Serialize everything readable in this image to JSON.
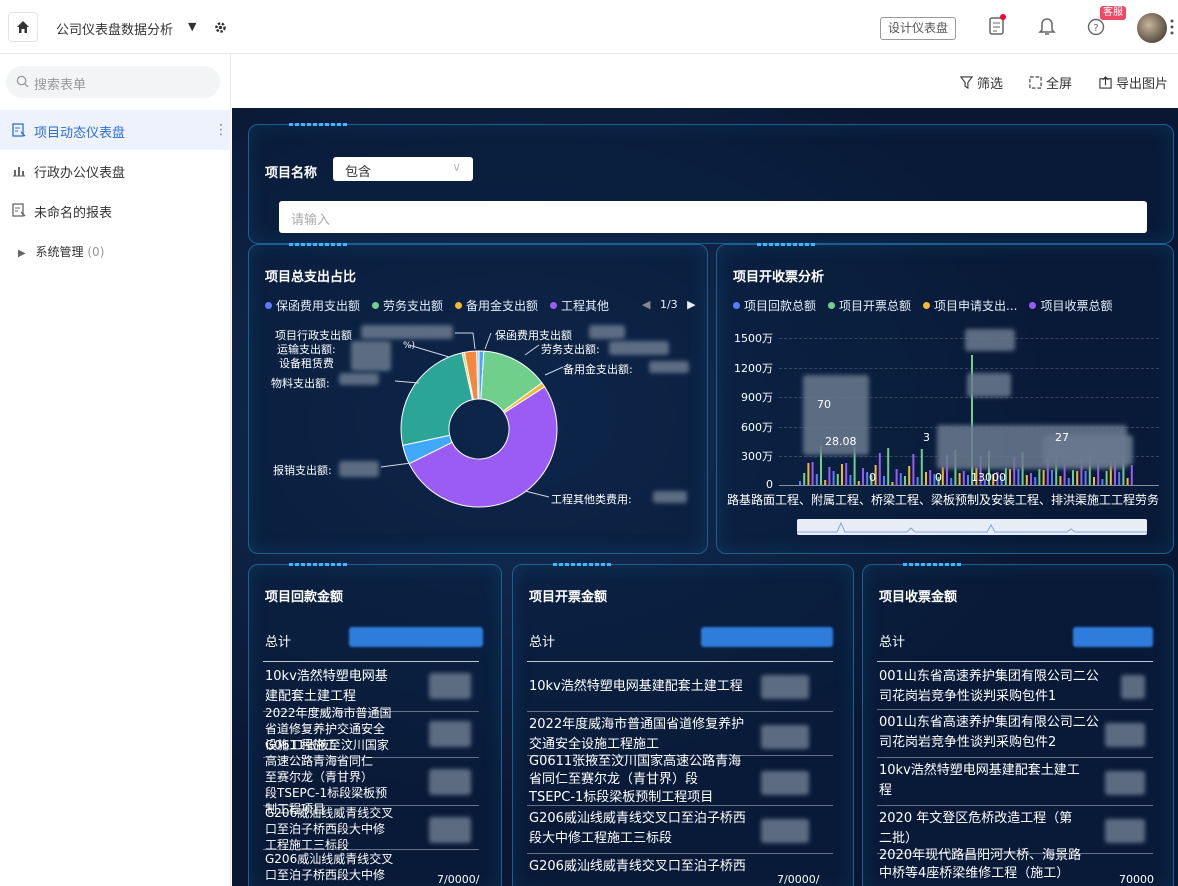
{
  "header": {
    "app_title": "公司仪表盘数据分析",
    "design_label": "设计仪表盘",
    "support_badge": "客服"
  },
  "sidebar": {
    "search_placeholder": "搜索表单",
    "items": [
      {
        "label": "项目动态仪表盘",
        "active": true
      },
      {
        "label": "行政办公仪表盘",
        "active": false
      },
      {
        "label": "未命名的报表",
        "active": false
      }
    ],
    "group": {
      "label": "系统管理",
      "count": "(0)"
    }
  },
  "toolbar": {
    "filter": "筛选",
    "fullscreen": "全屏",
    "export": "导出图片"
  },
  "filter_panel": {
    "label": "项目名称",
    "operator": "包含",
    "placeholder": "请输入"
  },
  "pie_panel": {
    "title": "项目总支出占比",
    "legend": [
      "保函费用支出额",
      "劳务支出额",
      "备用金支出额",
      "工程其他"
    ],
    "pager": "1/3",
    "labels": [
      "项目行政支出额",
      "运输支出额:",
      "设备租赁费",
      "物料支出额:",
      "报销支出额:",
      "保函费用支出额",
      "劳务支出额:",
      "备用金支出额:",
      "工程其他类费用: "
    ],
    "pct_hint": "%)"
  },
  "bar_panel": {
    "title": "项目开收票分析",
    "legend": [
      "项目回款总额",
      "项目开票总额",
      "项目申请支出...",
      "项目收票总额"
    ],
    "yticks": [
      "1500万",
      "1200万",
      "900万",
      "600万",
      "300万",
      "0"
    ],
    "xcats": "路基路面工程、附属工程、桥梁工程、梁板预制及安装工程、排洪渠施工工程劳务",
    "fragments": [
      "70",
      "28.08",
      "3",
      "27",
      "0",
      "13000",
      "0"
    ]
  },
  "cards": [
    {
      "title": "项目回款金额",
      "total_label": "总计",
      "rows": [
        "10kv浩然特塑电网基\n建配套土建工程",
        "2022年度威海市普通国\n省道修复养护交通安全\n设施工程施工",
        "G0611张掖至汶川国家\n高速公路青海省同仁\n至赛尔龙（青甘界）\n段TSEPC-1标段梁板预\n制工程项目",
        "G206威汕线威青线交叉\n口至泊子桥西段大中修\n工程施工三标段",
        "G206威汕线威青线交叉\n口至泊子桥西段大中修"
      ],
      "tail": "7/0000/"
    },
    {
      "title": "项目开票金额",
      "total_label": "总计",
      "rows": [
        "10kv浩然特塑电网基建配套土建工程",
        "2022年度威海市普通国省道修复养护\n交通安全设施工程施工",
        "G0611张掖至汶川国家高速公路青海\n省同仁至赛尔龙（青甘界）段\nTSEPC-1标段梁板预制工程项目",
        "G206威汕线威青线交叉口至泊子桥西\n段大中修工程施工三标段",
        "G206威汕线威青线交叉口至泊子桥西"
      ],
      "tail": "7/0000/"
    },
    {
      "title": "项目收票金额",
      "total_label": "总计",
      "rows": [
        "001山东省高速养护集团有限公司二公\n司花岗岩竞争性谈判采购包件1",
        "001山东省高速养护集团有限公司二公\n司花岗岩竞争性谈判采购包件2",
        "10kv浩然特塑电网基建配套土建工\n程",
        "2020 年文登区危桥改造工程（第\n二批）",
        "2020年现代路昌阳河大桥、海景路\n中桥等4座桥梁维修工程（施工）"
      ],
      "tail": "70000"
    }
  ],
  "colors": {
    "blue": "#5b7cfa",
    "green": "#6fcf8b",
    "yellow": "#f5b82e",
    "purple": "#9b5cf6",
    "orange": "#f5883c",
    "teal": "#2aa596",
    "sky": "#41a8ff"
  },
  "chart_data": {
    "type": "pie",
    "categories": [
      "保函费用支出额",
      "劳务支出额",
      "备用金支出额",
      "工程其他类费用",
      "报销支出额",
      "物料支出额",
      "设备租赁费",
      "运输支出额",
      "项目行政支出额"
    ],
    "values": [
      1,
      14,
      1,
      52,
      4,
      25,
      0.5,
      2.5,
      0.5
    ],
    "colors": [
      "#41a8ff",
      "#6fcf8b",
      "#f5b82e",
      "#9b5cf6",
      "#41a8ff",
      "#2aa596",
      "#e0c95a",
      "#f5883c",
      "#c0c0c0"
    ],
    "title": "项目总支出占比"
  }
}
